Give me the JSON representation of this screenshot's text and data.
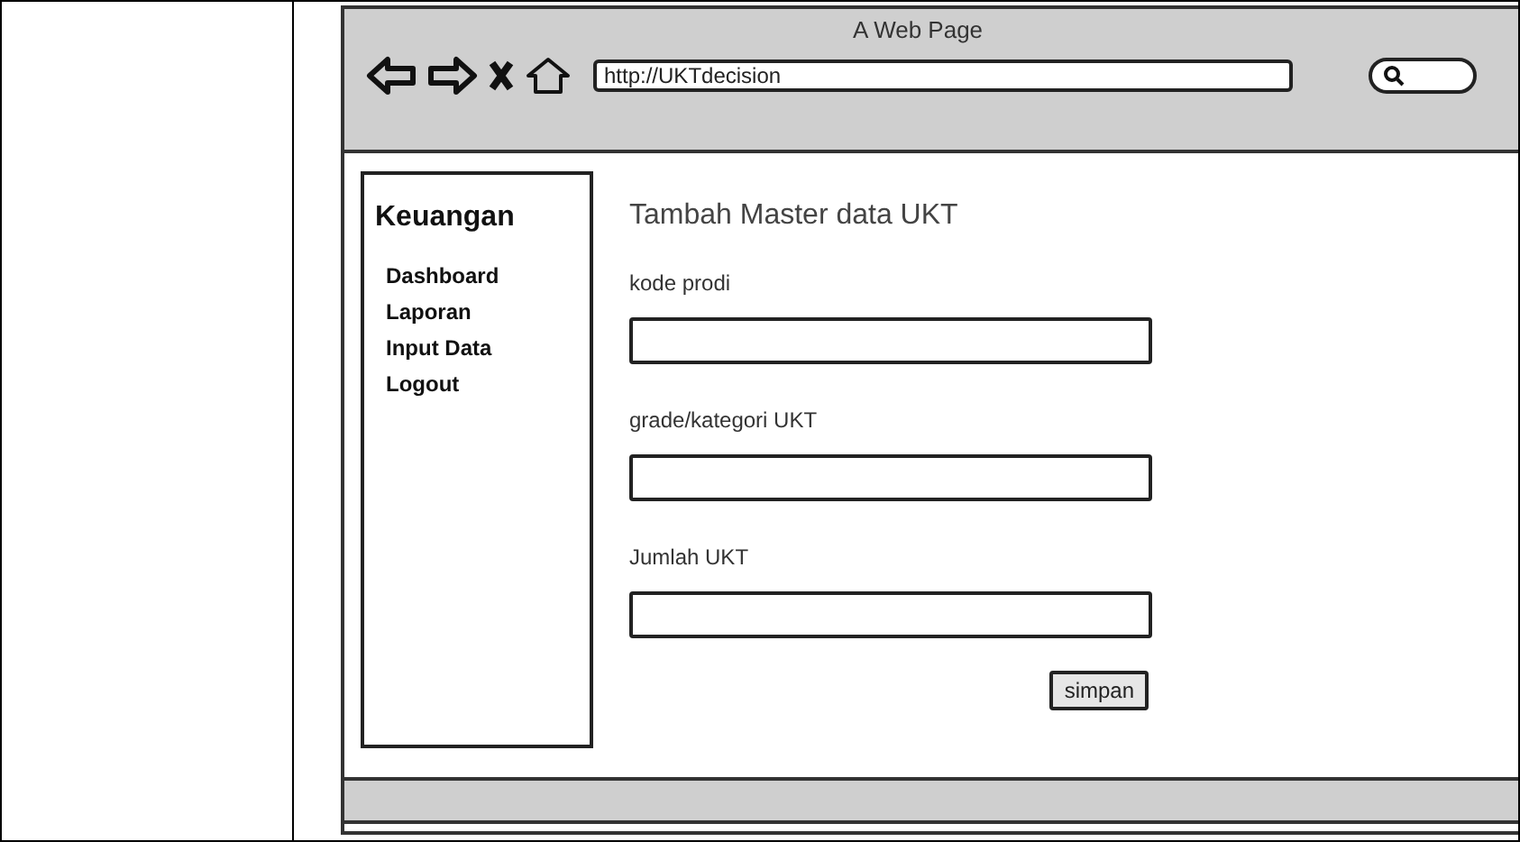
{
  "window": {
    "title": "A Web Page"
  },
  "address_bar": {
    "value": "http://UKTdecision"
  },
  "sidebar": {
    "title": "Keuangan",
    "items": [
      {
        "label": "Dashboard"
      },
      {
        "label": "Laporan"
      },
      {
        "label": "Input Data"
      },
      {
        "label": "Logout"
      }
    ]
  },
  "form": {
    "title": "Tambah Master data UKT",
    "fields": [
      {
        "label": "kode prodi"
      },
      {
        "label": "grade/kategori UKT"
      },
      {
        "label": "Jumlah UKT"
      }
    ],
    "submit": "simpan"
  }
}
